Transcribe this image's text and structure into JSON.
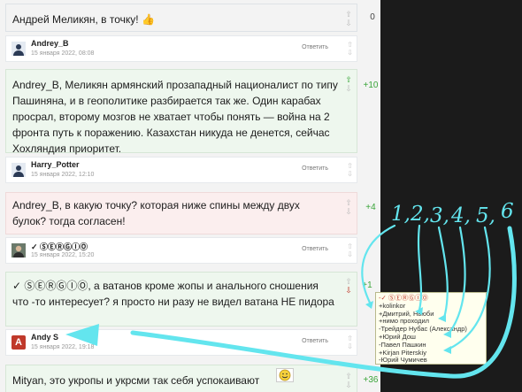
{
  "comments": [
    {
      "id": 1,
      "text": "Андрей Меликян, в точку! 👍",
      "score": "0"
    },
    {
      "id": 2,
      "text": "Andrey_B, Меликян армянский прозападный националист по типу Пашиняна, и в геополитике разбирается так же. Один карабах просрал, второму мозгов не хватает чтобы понять — война на 2 фронта путь к поражению. Казахстан никуда не денется, сейчас Хохляндия  приоритет.",
      "score": "+10"
    },
    {
      "id": 3,
      "text": "Andrey_B, в какую точку? которая ниже спины между двух булок? тогда согласен!",
      "score": "+4"
    },
    {
      "id": 4,
      "text": "✓ ⓈⒺⓇⒼⒾⓄ, а ватанов кроме жопы и анального сношения что -то интересует? я просто ни  разу не видел ватана НЕ пидора",
      "score": "+1"
    },
    {
      "id": 5,
      "text": "Mityan, это укропы и укрсми так себя успокаивают",
      "score": "+36"
    }
  ],
  "authors": [
    {
      "name": "Andrey_B",
      "date": "15 января 2022, 08:08",
      "reply": "Ответить"
    },
    {
      "name": "Harry_Potter",
      "date": "15 января 2022, 12:10",
      "reply": "Ответить"
    },
    {
      "name": "✓ ⓈⒺⓇⒼⒾⓄ",
      "date": "15 января 2022, 15:20",
      "reply": "Ответить"
    },
    {
      "name": "Andy S",
      "date": "15 января 2022, 19:18",
      "reply": "Ответить",
      "avatar_letter": "A"
    }
  ],
  "popup": [
    "-✓ ⓈⒺⓇⒼⒾⓄ",
    "+kolinkor",
    "+Дмитрий, Ньюби",
    "+нимо проходил",
    "-Трейдер Нубас (Александр)",
    "+Юрий Дош",
    "-Павел Пашкин",
    "+Kirjan Piterskiy",
    "-Юрий Чумичев"
  ],
  "annotation_numbers": [
    "1,",
    "2,",
    "3,",
    "4,",
    "5,",
    "6"
  ],
  "colors": {
    "accent_cyan": "#63e5ee",
    "positive": "#3aa53a",
    "negative": "#c0392b",
    "neutral": "#444444",
    "avatar_andy": "#c0392b"
  },
  "icons": {
    "vote_up": "up-arrow-icon",
    "vote_down": "down-arrow-icon",
    "smiley": "smiley-icon"
  }
}
